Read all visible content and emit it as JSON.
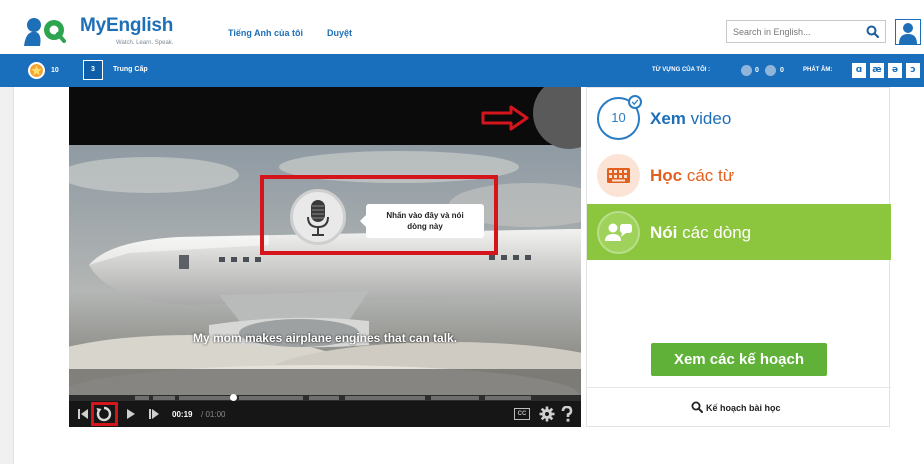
{
  "header": {
    "logo_title": "MyEnglish",
    "logo_tagline": "Watch. Learn. Speak.",
    "nav": [
      "Tiếng Anh của tôi",
      "Duyệt"
    ],
    "search_placeholder": "Search in English..."
  },
  "toolbar": {
    "stars": "10",
    "level_number": "3",
    "level_name": "Trung Cấp",
    "vocab_label": "TỪ VỰNG CỦA TÔI :",
    "vocab_counts": [
      "0",
      "0"
    ],
    "phonetics_label": "PHÁT ÂM:",
    "phonetics": [
      "ɑ",
      "æ",
      "ə",
      "ɔ"
    ]
  },
  "video": {
    "subtitle": "My mom makes airplane engines that can talk.",
    "mic_tooltip_line1": "Nhấn vào đây và nói",
    "mic_tooltip_line2": "dòng này",
    "time_current": "00:19",
    "time_total": "/ 01:00",
    "cc_label": "CC",
    "progress_fraction": 0.32
  },
  "panel": {
    "steps": [
      {
        "badge": "10",
        "bold": "Xem",
        "rest": " video"
      },
      {
        "bold": "Học",
        "rest": " các từ"
      },
      {
        "bold": "Nói",
        "rest": " các dòng"
      }
    ],
    "plans_button": "Xem các kế hoạch",
    "lesson_plan_link": "Kế hoạch bài học"
  },
  "colors": {
    "brand_blue": "#1a6fbd",
    "annotation_red": "#d4161c",
    "active_green": "#8cc63f",
    "plans_green": "#5fb138",
    "orange": "#e2601f"
  }
}
